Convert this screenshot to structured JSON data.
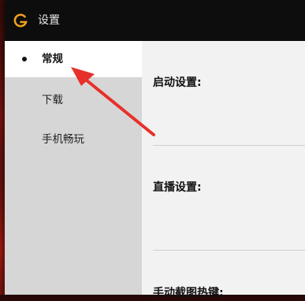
{
  "window": {
    "title": "设置",
    "logo_icon": "brand-g-logo-icon",
    "accent_color": "#f0a020"
  },
  "sidebar": {
    "items": [
      {
        "label": "常规",
        "active": true
      },
      {
        "label": "下载",
        "active": false
      },
      {
        "label": "手机畅玩",
        "active": false
      }
    ]
  },
  "content": {
    "sections": [
      {
        "title": "启动设置:"
      },
      {
        "title": "直播设置:"
      },
      {
        "title": "手动截图热键:"
      }
    ]
  },
  "annotation": {
    "arrow_color": "#e8302a"
  }
}
